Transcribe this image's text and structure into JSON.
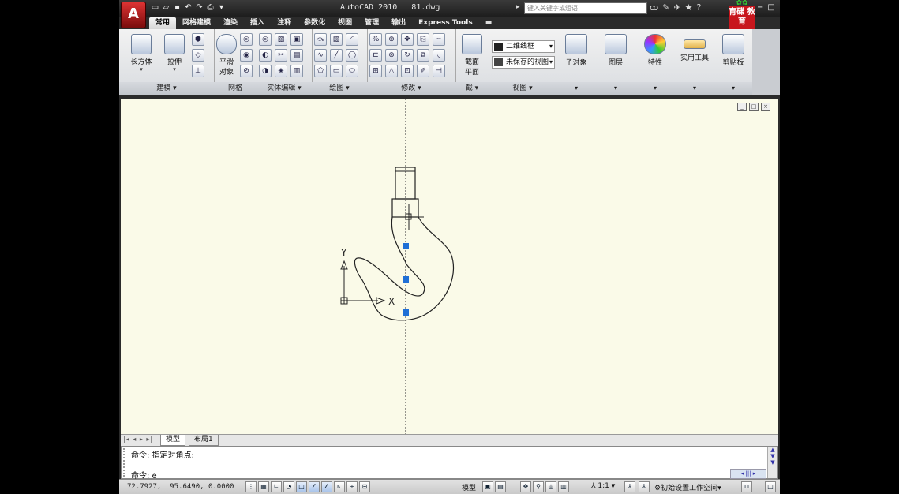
{
  "app": {
    "title": "AutoCAD 2010   81.dwg",
    "app_button_glyph": "A",
    "search_placeholder": "键入关键字或短语",
    "logo_text": "育碟 教育",
    "logo_color": "#c8161d"
  },
  "quick_access": {
    "icons": [
      "new-icon",
      "open-icon",
      "save-icon",
      "undo-icon",
      "redo-icon",
      "plot-icon",
      "dropdown-icon"
    ]
  },
  "title_icons": [
    "binoculars-icon",
    "wrench-icon",
    "star-icon",
    "help-icon"
  ],
  "window_controls": [
    "−",
    "□",
    "×"
  ],
  "tabs": [
    {
      "label": "常用",
      "active": true
    },
    {
      "label": "网格建模",
      "active": false
    },
    {
      "label": "渲染",
      "active": false
    },
    {
      "label": "插入",
      "active": false
    },
    {
      "label": "注释",
      "active": false
    },
    {
      "label": "参数化",
      "active": false
    },
    {
      "label": "视图",
      "active": false
    },
    {
      "label": "管理",
      "active": false
    },
    {
      "label": "输出",
      "active": false
    },
    {
      "label": "Express Tools",
      "active": false
    }
  ],
  "ribbon": {
    "panels": {
      "modeling": {
        "title": "建模 ▾",
        "box": "长方体",
        "extrude": "拉伸"
      },
      "mesh": {
        "title": "网格",
        "smooth": "平滑\n对象",
        "smooth_line1": "平滑",
        "smooth_line2": "对象"
      },
      "solid_edit": {
        "title": "实体编辑 ▾"
      },
      "draw": {
        "title": "绘图 ▾"
      },
      "modify": {
        "title": "修改 ▾"
      },
      "section": {
        "title": "截 ▾",
        "section_plane_line1": "截面",
        "section_plane_line2": "平面"
      },
      "view": {
        "title": "视图 ▾",
        "visual_style": "二维线框",
        "saved_view": "未保存的视图"
      },
      "subobject": {
        "label": "子对象"
      },
      "layers": {
        "label": "图层"
      },
      "properties": {
        "label": "特性"
      },
      "utilities": {
        "label": "实用工具"
      },
      "clipboard": {
        "label": "剪贴板"
      }
    }
  },
  "drawing": {
    "background": "#fafae8",
    "ucs_x": "X",
    "ucs_y": "Y",
    "grip_color": "#1f6fd6"
  },
  "layout_tabs": [
    {
      "label": "模型",
      "active": true
    },
    {
      "label": "布局1",
      "active": false
    }
  ],
  "command": {
    "line1": "命令: 指定对角点:",
    "line2": "命令: e"
  },
  "status": {
    "coords": "72.7927,  95.6490, 0.0000",
    "model_label": "模型",
    "anno_scale": "1:1",
    "workspace": "初始设置工作空间"
  }
}
